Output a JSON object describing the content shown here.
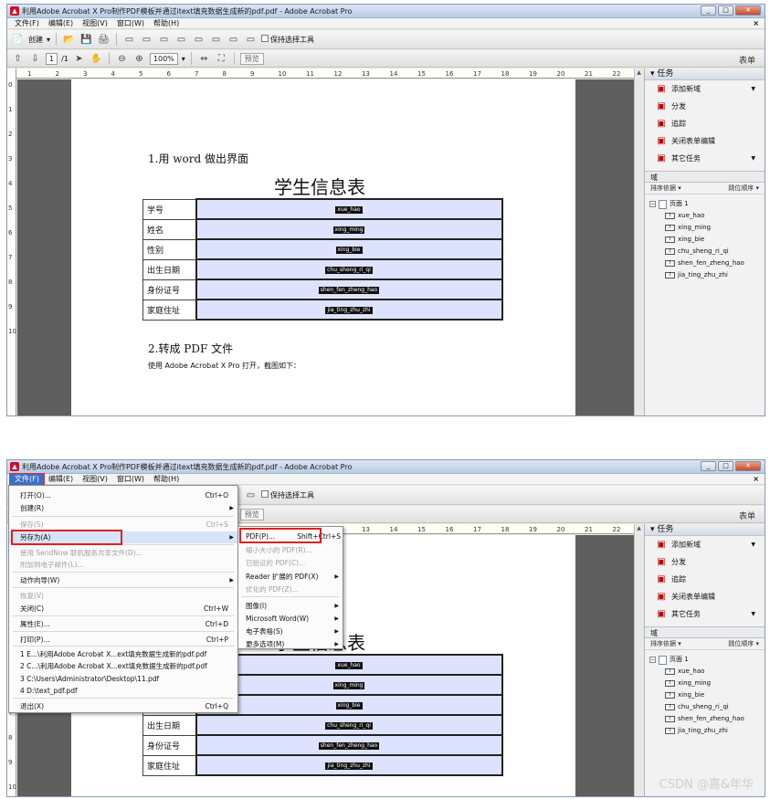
{
  "window": {
    "title": "利用Adobe Acrobat X Pro制作PDF模板并通过itext填充数据生成新的pdf.pdf - Adobe Acrobat Pro",
    "close_x": "×"
  },
  "menu": [
    "文件(F)",
    "编辑(E)",
    "视图(V)",
    "窗口(W)",
    "帮助(H)"
  ],
  "toolbar1": {
    "create": "创建",
    "keep_tool": "保持选择工具"
  },
  "toolbar2": {
    "page_current": "1",
    "page_total": "/1",
    "zoom": "100%",
    "preview": "预览"
  },
  "form_label": "表单",
  "ruler_ticks": [
    "1",
    "2",
    "3",
    "4",
    "5",
    "6",
    "7",
    "8",
    "9",
    "10",
    "11",
    "12",
    "13",
    "14",
    "15",
    "16",
    "17",
    "18",
    "19",
    "20",
    "21",
    "22"
  ],
  "ruler_v_ticks": [
    "0",
    "1",
    "2",
    "3",
    "4",
    "5",
    "6",
    "7",
    "8",
    "9",
    "10"
  ],
  "document": {
    "heading1": "1.用 word 做出界面",
    "table_title": "学生信息表",
    "rows": [
      {
        "label": "学号",
        "field": "xue_hao"
      },
      {
        "label": "姓名",
        "field": "xing_ming"
      },
      {
        "label": "性别",
        "field": "xing_bie"
      },
      {
        "label": "出生日期",
        "field": "chu_sheng_ri_qi"
      },
      {
        "label": "身份证号",
        "field": "shen_fen_zheng_hao"
      },
      {
        "label": "家庭住址",
        "field": "jia_ting_zhu_zhi"
      }
    ],
    "heading2": "2.转成 PDF 文件",
    "desc": "使用 Adobe Acrobat X Pro 打开，截图如下："
  },
  "panel": {
    "tasks_header": "▾ 任务",
    "tasks": [
      {
        "label": "添加新域",
        "icon": "add-field-icon",
        "caret": true
      },
      {
        "label": "分发",
        "icon": "distribute-icon",
        "caret": false
      },
      {
        "label": "追踪",
        "icon": "track-icon",
        "caret": false
      },
      {
        "label": "关闭表单编辑",
        "icon": "close-edit-icon",
        "caret": false
      },
      {
        "label": "其它任务",
        "icon": "other-tasks-icon",
        "caret": true
      }
    ],
    "fields_header": "域",
    "sort_by": "排序依据 ▾",
    "tab_order": "跳位顺序 ▾",
    "page_node": "页面 1",
    "field_nodes": [
      "xue_hao",
      "xing_ming",
      "xing_bie",
      "chu_sheng_ri_qi",
      "shen_fen_zheng_hao",
      "jia_ting_zhu_zhi"
    ]
  },
  "file_menu": [
    {
      "label": "打开(O)...",
      "shortcut": "Ctrl+O",
      "sub": false,
      "disabled": false
    },
    {
      "label": "创建(R)",
      "shortcut": "",
      "sub": true,
      "disabled": false
    },
    {
      "label": "保存(S)",
      "shortcut": "Ctrl+S",
      "sub": false,
      "disabled": true
    },
    {
      "label": "另存为(A)",
      "shortcut": "",
      "sub": true,
      "disabled": false
    },
    {
      "label": "使用 SendNow 联机服务共享文件(D)...",
      "shortcut": "",
      "sub": false,
      "disabled": true
    },
    {
      "label": "附加到电子邮件(L)...",
      "shortcut": "",
      "sub": false,
      "disabled": true
    },
    {
      "label": "动作向导(W)",
      "shortcut": "",
      "sub": true,
      "disabled": false
    },
    {
      "label": "恢复(V)",
      "shortcut": "",
      "sub": false,
      "disabled": true
    },
    {
      "label": "关闭(C)",
      "shortcut": "Ctrl+W",
      "sub": false,
      "disabled": false
    },
    {
      "label": "属性(E)...",
      "shortcut": "Ctrl+D",
      "sub": false,
      "disabled": false
    },
    {
      "label": "打印(P)...",
      "shortcut": "Ctrl+P",
      "sub": false,
      "disabled": false
    },
    {
      "label": "1 E...\\利用Adobe Acrobat X...ext填充数据生成新的pdf.pdf",
      "shortcut": "",
      "sub": false,
      "disabled": false
    },
    {
      "label": "2 C...\\利用Adobe Acrobat X...ext填充数据生成新的pdf.pdf",
      "shortcut": "",
      "sub": false,
      "disabled": false
    },
    {
      "label": "3 C:\\Users\\Administrator\\Desktop\\11.pdf",
      "shortcut": "",
      "sub": false,
      "disabled": false
    },
    {
      "label": "4 D:\\text_pdf.pdf",
      "shortcut": "",
      "sub": false,
      "disabled": false
    },
    {
      "label": "退出(X)",
      "shortcut": "Ctrl+Q",
      "sub": false,
      "disabled": false
    }
  ],
  "saveas_menu": [
    {
      "label": "PDF(P)...",
      "shortcut": "Shift+Ctrl+S",
      "sub": false,
      "disabled": false
    },
    {
      "label": "缩小大小的 PDF(R)...",
      "shortcut": "",
      "sub": false,
      "disabled": true
    },
    {
      "label": "已验证的 PDF(C)...",
      "shortcut": "",
      "sub": false,
      "disabled": true
    },
    {
      "label": "Reader 扩展的 PDF(X)",
      "shortcut": "",
      "sub": true,
      "disabled": false
    },
    {
      "label": "优化的 PDF(Z)...",
      "shortcut": "",
      "sub": false,
      "disabled": true
    },
    {
      "label": "图像(I)",
      "shortcut": "",
      "sub": true,
      "disabled": false
    },
    {
      "label": "Microsoft Word(W)",
      "shortcut": "",
      "sub": true,
      "disabled": false
    },
    {
      "label": "电子表格(S)",
      "shortcut": "",
      "sub": true,
      "disabled": false
    },
    {
      "label": "更多选项(M)",
      "shortcut": "",
      "sub": true,
      "disabled": false
    }
  ],
  "watermark": "CSDN @嘉&年华"
}
